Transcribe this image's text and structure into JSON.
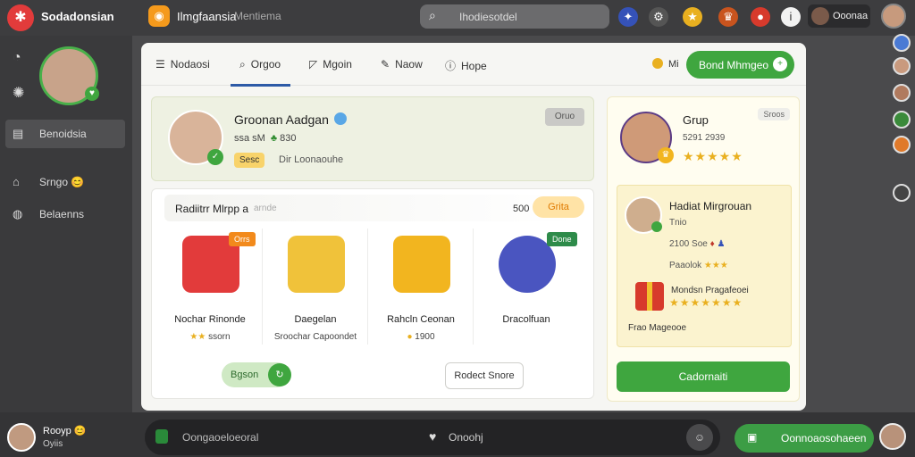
{
  "topbar": {
    "brand": "Sodadonsian",
    "app_title": "Ilmgfaansia",
    "app_subtitle": "Mentiema",
    "search_text": "Ihodiesotdel",
    "user_label": "Ooonaa"
  },
  "sidebar": {
    "items": [
      {
        "label": "Benoidsia",
        "icon": "list-icon"
      },
      {
        "label": "Srngo 😊",
        "icon": "home-icon"
      },
      {
        "label": "Belaenns",
        "icon": "globe-icon"
      }
    ]
  },
  "panel": {
    "tabs": [
      {
        "label": "Nodaosi",
        "icon": "menu-icon"
      },
      {
        "label": "Orgoo",
        "icon": "search-icon"
      },
      {
        "label": "Mgoin",
        "icon": "chat-icon"
      },
      {
        "label": "Naow",
        "icon": "pen-icon"
      },
      {
        "label": "Hope",
        "icon": "info-icon"
      }
    ],
    "coins": "Mi",
    "invite_button": "Bond Mhmgeo"
  },
  "profile": {
    "name": "Groonan Aadgan",
    "stats": "ssa sM",
    "stats_value": "830",
    "badge": "Sesc",
    "location": "Dir Loonaouhe",
    "follow_label": "Oruo"
  },
  "gifts": {
    "title": "Radiitrr Mlrpp a",
    "subtitle": "arnde",
    "count": "500",
    "pill": "Grita",
    "items": [
      {
        "name": "Nochar Rinonde",
        "price": "ssorn",
        "tag": "Orrs",
        "color": "#e23b3b"
      },
      {
        "name": "Daegelan",
        "price": "Sroochar Capoondet",
        "tag": "",
        "color": "#f0c23a"
      },
      {
        "name": "Rahcln Ceonan",
        "price": "1900",
        "tag": "",
        "color": "#f2b51f"
      },
      {
        "name": "Dracolfuan",
        "price": "",
        "tag": "Done",
        "color": "#4a55c0"
      }
    ],
    "more_button": "Bgson",
    "store_button": "Rodect Snore"
  },
  "group": {
    "title": "Grup",
    "id": "5291 2939",
    "corner": "Sroos",
    "stars": "★★★★★",
    "member": {
      "name": "Hadiat Mirgrouan",
      "line1": "Tnio",
      "line2": "2100 Soe",
      "line3": "Paaolok",
      "gift_label": "Mondsn Pragafeoei",
      "gift_stars": "★★★★★★★",
      "footer": "Frao Mageooe"
    },
    "join_button": "Cadornaiti"
  },
  "bottombar": {
    "user_name": "Rooyp 😊",
    "user_sub": "Oyiis",
    "input_placeholder": "Oongaoeloeoral",
    "heart_label": "Onoohj",
    "send_label": "Oonnoaosohaeen"
  }
}
